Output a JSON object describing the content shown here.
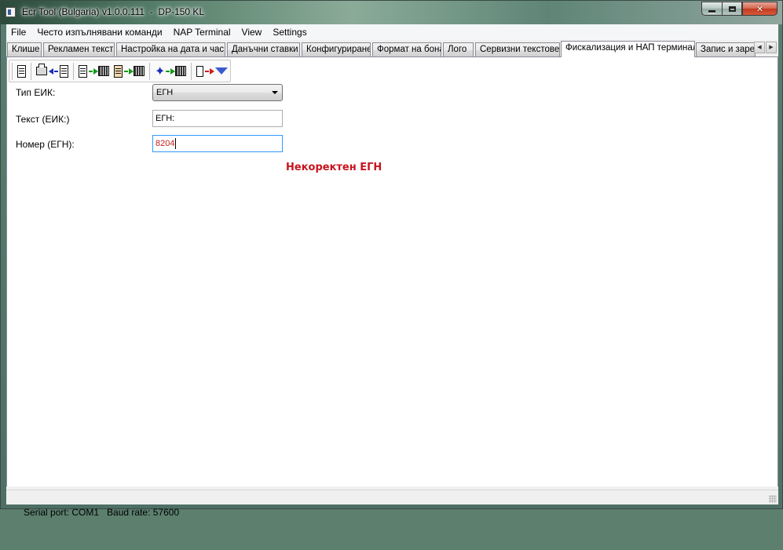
{
  "window": {
    "title": "Ecr Tool (Bulgaria) v1.0.0.111  -  DP-150 KL"
  },
  "menu": {
    "items": [
      "File",
      "Често изпълнявани команди",
      "NAP Terminal",
      "View",
      "Settings"
    ]
  },
  "tabs": {
    "items": [
      "Клише",
      "Рекламен текст",
      "Настройка на дата и час",
      "Данъчни ставки",
      "Конфигуриране",
      "Формат на бона",
      "Лого",
      "Сервизни текстове",
      "Фискализация и НАП терминал",
      "Запис и зареж"
    ],
    "active_index": 8
  },
  "toolbar": {
    "icons": [
      "document-icon",
      "printer-to-device-icon",
      "device-to-register-icon",
      "operator-to-register-icon",
      "person-to-register-icon",
      "device-to-dropdown-icon"
    ]
  },
  "form": {
    "eik_type_label": "Тип ЕИК:",
    "eik_type_value": "ЕГН",
    "eik_text_label": "Текст (ЕИК:)",
    "eik_text_value": "ЕГН:",
    "number_label": "Номер (ЕГН):",
    "number_value": "8204",
    "error_message": "Некоректен ЕГН"
  },
  "status": {
    "text": "Serial port: COM1   Baud rate: 57600"
  },
  "colors": {
    "error": "#c8141e",
    "focus_border": "#3399ff"
  }
}
